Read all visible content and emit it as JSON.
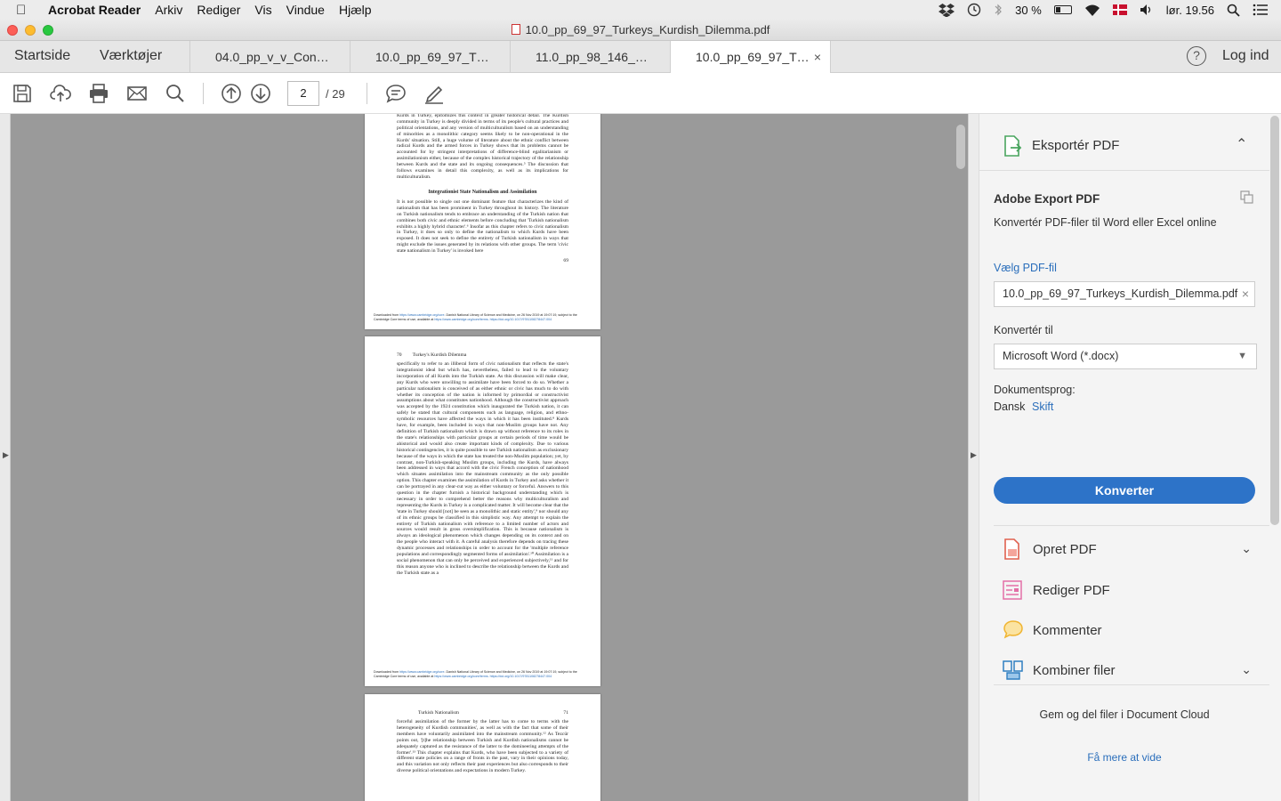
{
  "menubar": {
    "app_name": "Acrobat Reader",
    "items": [
      "Arkiv",
      "Rediger",
      "Vis",
      "Vindue",
      "Hjælp"
    ],
    "battery": "30 %",
    "clock": "lør. 19.56"
  },
  "window": {
    "title": "10.0_pp_69_97_Turkeys_Kurdish_Dilemma.pdf"
  },
  "tabs": {
    "home": "Startside",
    "tools": "Værktøjer",
    "documents": [
      "04.0_pp_v_v_Con…",
      "10.0_pp_69_97_T…",
      "11.0_pp_98_146_…",
      "10.0_pp_69_97_T…"
    ],
    "close_symbol": "×",
    "help_symbol": "?",
    "login": "Log ind"
  },
  "toolbar": {
    "current_page": "2",
    "total_pages": "/ 29"
  },
  "document": {
    "page1": {
      "paragraph_top": "important for conceptual and practical reasons. This example, by focusing on the Kurds in Turkey, epitomizes this context in greater historical detail. The Kurdish community in Turkey is deeply divided in terms of its people's cultural practices and political orientations, and any version of multiculturalism based on an understanding of minorities as a monolithic category seems likely to be non-operational in the Kurds' situation. Still, a huge volume of literature about the ethnic conflict between radical Kurds and the armed forces in Turkey shows that its problems cannot be accounted for by stringent interpretations of difference-blind egalitarianism or assimilationism either, because of the complex historical trajectory of the relationship between Kurds and the state and its ongoing consequences.⁵ The discussion that follows examines in detail this complexity, as well as its implications for multiculturalism.",
      "heading": "Integrationist State Nationalism and Assimilation",
      "paragraph_bottom": "It is not possible to single out one dominant feature that characterizes the kind of nationalism that has been prominent in Turkey throughout its history. The literature on Turkish nationalism tends to embrace an understanding of the Turkish nation that combines both civic and ethnic elements before concluding that 'Turkish nationalism exhibits a highly hybrid character'.⁶ Insofar as this chapter refers to civic nationalism in Turkey, it does so only to define the nationalism to which Kurds have been exposed. It does not seek to define the entirety of Turkish nationalism in ways that might exclude the issues generated by its relations with other groups. The term 'civic state nationalism in Turkey' is invoked here",
      "page_number": "69",
      "footer_prefix": "Downloaded from ",
      "footer_link": "https://www.cambridge.org/core",
      "footer_mid": ". Danish National Library of Science and Medicine, on 26 Nov 2019 at 19:07:19, subject to the Cambridge Core terms of use, available at ",
      "footer_link2": "https://www.cambridge.org/core/terms. https://doi.org/10.1017/9781108278447.004"
    },
    "page2": {
      "running_head_num": "70",
      "running_head": "Turkey's Kurdish Dilemma",
      "body": "specifically to refer to an illiberal form of civic nationalism that reflects the state's integrationist ideal but which has, nevertheless, failed to lead to the voluntary incorporation of all Kurds into the Turkish state. As this discussion will make clear, any Kurds who were unwilling to assimilate have been forced to do so. Whether a particular nationalism is conceived of as either ethnic or civic has much to do with whether its conception of the nation is informed by primordial or constructivist assumptions about what constitutes nationhood. Although the constructivist approach was accepted by the 1924 constitution which inaugurated the Turkish nation, it can safely be stated that cultural components such as language, religion, and ethno-symbolic resources have affected the ways in which it has been instituted.⁸ Kurds have, for example, been included in ways that non-Muslim groups have not. Any definition of Turkish nationalism which is drawn up without reference to its roles in the state's relationships with particular groups at certain periods of time would be ahistorical and would also create important kinds of complexity. Due to various historical contingencies, it is quite possible to see Turkish nationalism as exclusionary because of the ways in which the state has treated the non-Muslim population; yet, by contrast, non-Turkish-speaking Muslim groups, including the Kurds, have always been addressed in ways that accord with the civic French conception of nationhood which situates assimilation into the mainstream community as the only possible option. This chapter examines the assimilation of Kurds in Turkey and asks whether it can be portrayed in any clear-cut way as either voluntary or forceful. Answers to this question in the chapter furnish a historical background understanding which is necessary in order to comprehend better the reasons why multiculturalism and representing the Kurds in Turkey is a complicated matter. It will become clear that the 'state in Turkey should [not] be seen as a monolithic and static entity',⁹ nor should any of its ethnic groups be classified in this simplistic way. Any attempt to explain the entirety of Turkish nationalism with reference to a limited number of actors and sources would result in gross oversimplification. This is because nationalism is always an ideological phenomenon which changes depending on its context and on the people who interact with it. A careful analysis therefore depends on tracing these dynamic processes and relationships in order to account for the 'multiple reference populations and correspondingly segmented forms of assimilation'.¹⁰ Assimilation is a social phenomenon that can only be perceived and experienced subjectively,¹¹ and for this reason anyone who is inclined to describe the relationship between the Kurds and the Turkish state as a"
    },
    "page3": {
      "running_head": "Turkish Nationalism",
      "running_head_num": "71",
      "body": "forceful assimilation of the former by the latter has to come to terms with the heterogeneity of Kurdish communities', as well as with the fact that some of their members have voluntarily assimilated into the mainstream community.¹² As Tezcür points out, '[t]he relationship between Turkish and Kurdish nationalisms cannot be adequately captured as the resistance of the latter to the domineering attempts of the former'.¹³ This chapter explains that Kurds, who have been subjected to a variety of different state policies on a range of fronts in the past, vary in their opinions today, and this variation not only reflects their past experiences but also corresponds to their diverse political orientations and expectations in modern Turkey."
    }
  },
  "panel": {
    "export_title": "Eksportér PDF",
    "service_title": "Adobe Export PDF",
    "service_desc": "Konvertér PDF-filer til Word eller Excel online",
    "choose_file_label": "Vælg PDF-fil",
    "file_name": "10.0_pp_69_97_Turkeys_Kurdish_Dilemma.pdf",
    "clear_symbol": "×",
    "convert_to_label": "Konvertér til",
    "convert_to_value": "Microsoft Word (*.docx)",
    "language_label": "Dokumentsprog:",
    "language_value": "Dansk",
    "language_change": "Skift",
    "convert_button": "Konverter",
    "tools": [
      "Opret PDF",
      "Rediger PDF",
      "Kommenter",
      "Kombiner filer"
    ],
    "cloud_text": "Gem og del filer i Document Cloud",
    "learn_more": "Få mere at vide"
  },
  "colors": {
    "accent": "#2d73c8",
    "link": "#2a6ebb",
    "doc_background": "#9a9a9a"
  },
  "icons": [
    "apple-icon",
    "dropbox-icon",
    "time-machine-icon",
    "bluetooth-icon",
    "battery-icon",
    "wifi-icon",
    "danish-flag-icon",
    "volume-icon",
    "spotlight-icon",
    "notification-center-icon",
    "save-icon",
    "upload-icon",
    "print-icon",
    "email-icon",
    "search-icon",
    "previous-page-icon",
    "next-page-icon",
    "comment-icon",
    "sign-icon",
    "export-pdf-icon",
    "create-pdf-icon",
    "edit-pdf-icon",
    "comment-tool-icon",
    "combine-files-icon"
  ]
}
